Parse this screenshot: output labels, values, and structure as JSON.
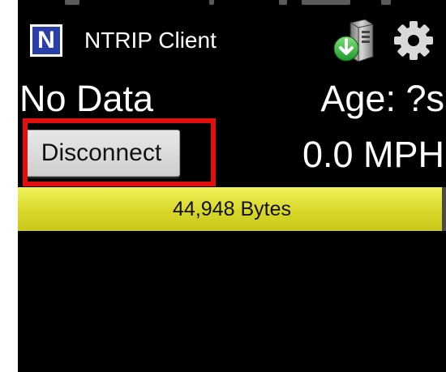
{
  "app": {
    "title": "NTRIP Client",
    "logo_letter": "N"
  },
  "status": {
    "data_state": "No Data",
    "age": "Age: ?s",
    "speed": "0.0 MPH"
  },
  "controls": {
    "disconnect_label": "Disconnect"
  },
  "progress": {
    "label": "44,948 Bytes",
    "fill_percent": 99
  },
  "icons": {
    "download": "download-server-icon",
    "settings": "gear-icon"
  },
  "colors": {
    "progress_fill": "#d7d72a",
    "highlight": "#e01010",
    "logo_bg": "#2b3fa8"
  }
}
